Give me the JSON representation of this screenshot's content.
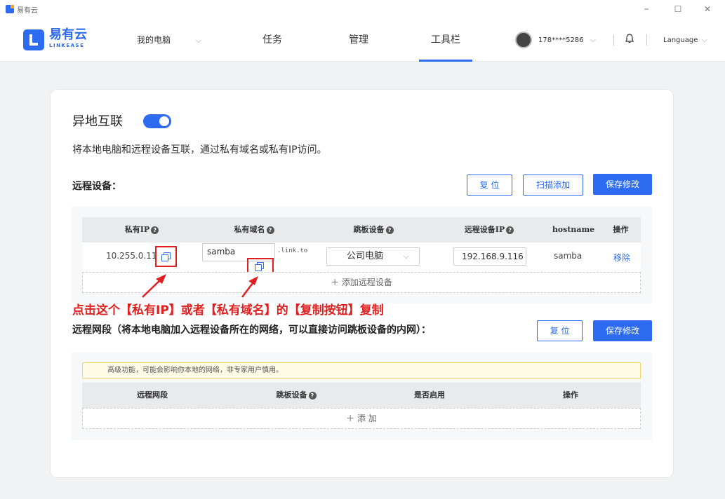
{
  "app": {
    "title": "易有云"
  },
  "window": {
    "minimize": "–",
    "maximize": "☐",
    "close": "✕"
  },
  "header": {
    "logo_text": "易有云",
    "logo_sub": "LINKEASE",
    "nav": [
      {
        "label": "我的电脑"
      },
      {
        "label": "任务"
      },
      {
        "label": "管理"
      },
      {
        "label": "工具栏"
      }
    ],
    "chevron": "⌵",
    "user": "178****5286",
    "language": "Language"
  },
  "page": {
    "title": "异地互联",
    "description": "将本地电脑和远程设备互联，通过私有域名或私有IP访问。",
    "remote_devices_label": "远程设备：",
    "buttons": {
      "reset": "复 位",
      "scan_add": "扫描添加",
      "save": "保存修改"
    },
    "table1": {
      "headers": [
        "私有IP",
        "私有域名",
        "跳板设备",
        "远程设备IP",
        "hostname",
        "操作"
      ],
      "help": "?",
      "row": {
        "private_ip": "10.255.0.11",
        "domain_value": "samba",
        "domain_suffix": ".link.to",
        "jump_device": "公司电脑",
        "remote_ip": "192.168.9.116",
        "hostname": "samba",
        "action": "移除"
      },
      "add_row": "＋ 添加远程设备"
    },
    "annotation": "点击这个【私有IP】或者【私有域名】的【复制按钮】复制",
    "network_label": "远程网段（将本地电脑加入远程设备所在的网络，可以直接访问跳板设备的内网）：",
    "network_buttons": {
      "reset": "复 位",
      "save": "保存修改"
    },
    "warning": "高级功能，可能会影响你本地的网络，非专家用户慎用。",
    "table2": {
      "headers": [
        "远程网段",
        "跳板设备",
        "是否启用",
        "操作"
      ],
      "add_row": "＋ 添 加"
    }
  },
  "colors": {
    "accent": "#2d6cf0",
    "annotation": "#e02020"
  }
}
